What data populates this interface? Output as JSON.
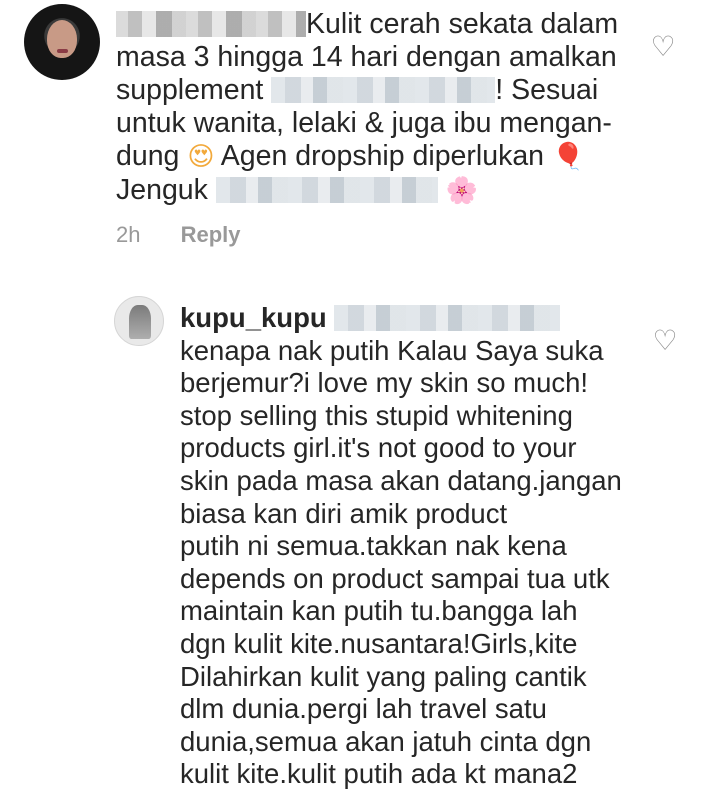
{
  "comments": [
    {
      "text_l1": "Kulit cerah sekata dalam",
      "text_l2": "masa 3 hingga 14 hari dengan amalkan",
      "text_l3a": "supplement",
      "text_l3b": "! Sesuai",
      "text_l4": "untuk wanita, lelaki & juga ibu mengan-",
      "text_l5a": "dung",
      "emoji_heart_eyes": "😍",
      "text_l5b": "Agen dropship diperlukan",
      "emoji_balloon": "🎈",
      "text_l6a": "Jenguk",
      "emoji_flower": "🌸",
      "time": "2h",
      "reply_label": "Reply"
    },
    {
      "username": "kupu_kupu",
      "lines": [
        "kenapa nak putih Kalau Saya suka",
        "berjemur?i love my skin so much!",
        "stop selling this stupid whitening",
        "products girl.it's not good to your",
        "skin pada masa akan datang.jangan",
        "biasa kan diri amik product",
        "putih ni semua.takkan nak kena",
        "depends on product sampai tua utk",
        "maintain kan putih tu.bangga lah",
        "dgn kulit kite.nusantara!Girls,kite",
        "Dilahirkan kulit yang paling cantik",
        "dlm dunia.pergi lah travel satu",
        "dunia,semua akan jatuh cinta dgn",
        "kulit kite.kulit putih ada kt mana2"
      ]
    }
  ],
  "icons": {
    "like": "♡"
  }
}
